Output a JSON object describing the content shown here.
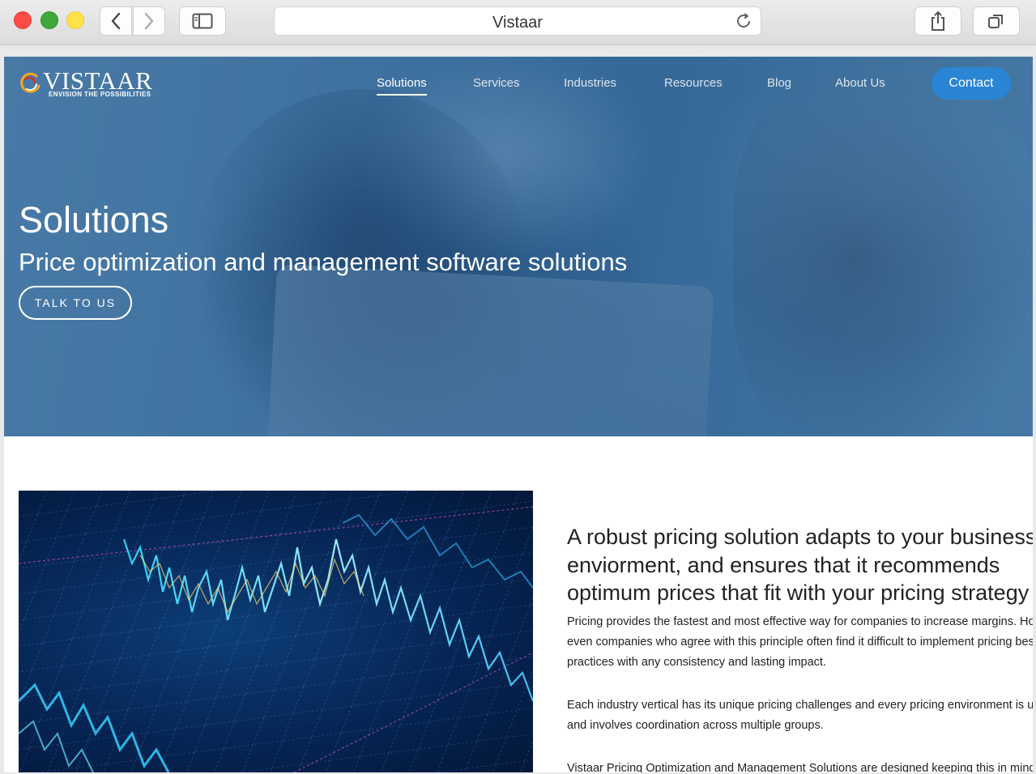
{
  "browser": {
    "tab_title": "Vistaar",
    "icons": [
      "back-icon",
      "forward-icon",
      "sidebar-icon",
      "reload-icon",
      "share-icon",
      "tabs-icon"
    ]
  },
  "site": {
    "logo_text": "VISTAAR",
    "logo_tagline": "ENVISION THE POSSIBILITIES",
    "nav": {
      "solutions": "Solutions",
      "services": "Services",
      "industries": "Industries",
      "resources": "Resources",
      "blog": "Blog",
      "about": "About Us",
      "contact": "Contact"
    },
    "active_nav": "Solutions",
    "colors": {
      "contact": "#2a85d4",
      "hero_overlay": "#2a6aa3"
    }
  },
  "hero": {
    "title": "Solutions",
    "subtitle": "Price optimization and management software solutions",
    "cta": "TALK TO US"
  },
  "article": {
    "heading": "A robust pricing solution adapts to your business enviorment, and ensures that it recommends optimum prices that fit with your pricing strategy",
    "paragraph1": "Pricing provides the fastest and most effective way for companies to increase margins. However, even companies who agree with this principle often find it difficult to implement pricing best practices with any consistency and lasting impact.",
    "paragraph2": "Each industry vertical has its unique pricing challenges and every pricing environment is unique and involves coordination across multiple groups.",
    "paragraph3": "Vistaar Pricing Optimization and Management Solutions are designed keeping this in mind"
  }
}
